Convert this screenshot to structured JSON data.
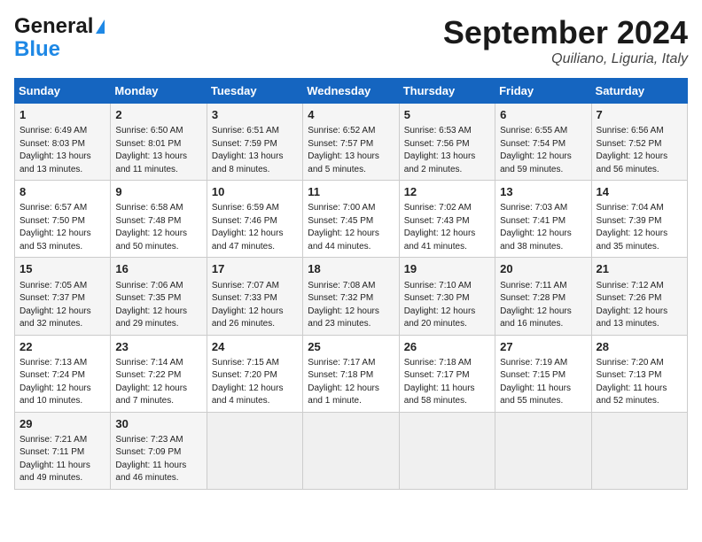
{
  "logo": {
    "line1": "General",
    "line2": "Blue"
  },
  "header": {
    "month": "September 2024",
    "location": "Quiliano, Liguria, Italy"
  },
  "weekdays": [
    "Sunday",
    "Monday",
    "Tuesday",
    "Wednesday",
    "Thursday",
    "Friday",
    "Saturday"
  ],
  "weeks": [
    [
      {
        "day": "1",
        "sunrise": "6:49 AM",
        "sunset": "8:03 PM",
        "daylight": "13 hours and 13 minutes."
      },
      {
        "day": "2",
        "sunrise": "6:50 AM",
        "sunset": "8:01 PM",
        "daylight": "13 hours and 11 minutes."
      },
      {
        "day": "3",
        "sunrise": "6:51 AM",
        "sunset": "7:59 PM",
        "daylight": "13 hours and 8 minutes."
      },
      {
        "day": "4",
        "sunrise": "6:52 AM",
        "sunset": "7:57 PM",
        "daylight": "13 hours and 5 minutes."
      },
      {
        "day": "5",
        "sunrise": "6:53 AM",
        "sunset": "7:56 PM",
        "daylight": "13 hours and 2 minutes."
      },
      {
        "day": "6",
        "sunrise": "6:55 AM",
        "sunset": "7:54 PM",
        "daylight": "12 hours and 59 minutes."
      },
      {
        "day": "7",
        "sunrise": "6:56 AM",
        "sunset": "7:52 PM",
        "daylight": "12 hours and 56 minutes."
      }
    ],
    [
      {
        "day": "8",
        "sunrise": "6:57 AM",
        "sunset": "7:50 PM",
        "daylight": "12 hours and 53 minutes."
      },
      {
        "day": "9",
        "sunrise": "6:58 AM",
        "sunset": "7:48 PM",
        "daylight": "12 hours and 50 minutes."
      },
      {
        "day": "10",
        "sunrise": "6:59 AM",
        "sunset": "7:46 PM",
        "daylight": "12 hours and 47 minutes."
      },
      {
        "day": "11",
        "sunrise": "7:00 AM",
        "sunset": "7:45 PM",
        "daylight": "12 hours and 44 minutes."
      },
      {
        "day": "12",
        "sunrise": "7:02 AM",
        "sunset": "7:43 PM",
        "daylight": "12 hours and 41 minutes."
      },
      {
        "day": "13",
        "sunrise": "7:03 AM",
        "sunset": "7:41 PM",
        "daylight": "12 hours and 38 minutes."
      },
      {
        "day": "14",
        "sunrise": "7:04 AM",
        "sunset": "7:39 PM",
        "daylight": "12 hours and 35 minutes."
      }
    ],
    [
      {
        "day": "15",
        "sunrise": "7:05 AM",
        "sunset": "7:37 PM",
        "daylight": "12 hours and 32 minutes."
      },
      {
        "day": "16",
        "sunrise": "7:06 AM",
        "sunset": "7:35 PM",
        "daylight": "12 hours and 29 minutes."
      },
      {
        "day": "17",
        "sunrise": "7:07 AM",
        "sunset": "7:33 PM",
        "daylight": "12 hours and 26 minutes."
      },
      {
        "day": "18",
        "sunrise": "7:08 AM",
        "sunset": "7:32 PM",
        "daylight": "12 hours and 23 minutes."
      },
      {
        "day": "19",
        "sunrise": "7:10 AM",
        "sunset": "7:30 PM",
        "daylight": "12 hours and 20 minutes."
      },
      {
        "day": "20",
        "sunrise": "7:11 AM",
        "sunset": "7:28 PM",
        "daylight": "12 hours and 16 minutes."
      },
      {
        "day": "21",
        "sunrise": "7:12 AM",
        "sunset": "7:26 PM",
        "daylight": "12 hours and 13 minutes."
      }
    ],
    [
      {
        "day": "22",
        "sunrise": "7:13 AM",
        "sunset": "7:24 PM",
        "daylight": "12 hours and 10 minutes."
      },
      {
        "day": "23",
        "sunrise": "7:14 AM",
        "sunset": "7:22 PM",
        "daylight": "12 hours and 7 minutes."
      },
      {
        "day": "24",
        "sunrise": "7:15 AM",
        "sunset": "7:20 PM",
        "daylight": "12 hours and 4 minutes."
      },
      {
        "day": "25",
        "sunrise": "7:17 AM",
        "sunset": "7:18 PM",
        "daylight": "12 hours and 1 minute."
      },
      {
        "day": "26",
        "sunrise": "7:18 AM",
        "sunset": "7:17 PM",
        "daylight": "11 hours and 58 minutes."
      },
      {
        "day": "27",
        "sunrise": "7:19 AM",
        "sunset": "7:15 PM",
        "daylight": "11 hours and 55 minutes."
      },
      {
        "day": "28",
        "sunrise": "7:20 AM",
        "sunset": "7:13 PM",
        "daylight": "11 hours and 52 minutes."
      }
    ],
    [
      {
        "day": "29",
        "sunrise": "7:21 AM",
        "sunset": "7:11 PM",
        "daylight": "11 hours and 49 minutes."
      },
      {
        "day": "30",
        "sunrise": "7:23 AM",
        "sunset": "7:09 PM",
        "daylight": "11 hours and 46 minutes."
      },
      null,
      null,
      null,
      null,
      null
    ]
  ]
}
